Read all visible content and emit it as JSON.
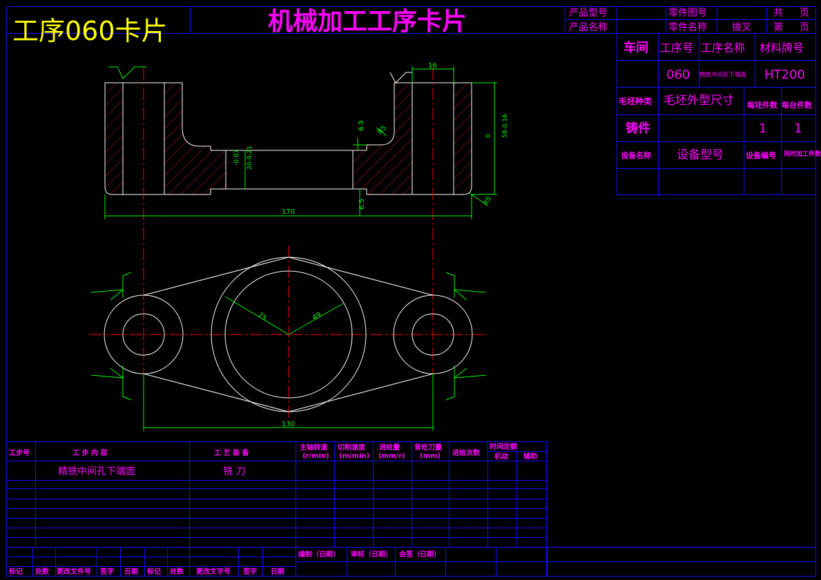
{
  "header": {
    "process_title": "工序060卡片",
    "card_title": "机械加工工序卡片",
    "product_model_label": "产品型号",
    "product_name_label": "产品名称",
    "part_drawing_no_label": "零件图号",
    "part_name_label": "零件名称",
    "part_name_value": "拨叉",
    "total_label": "共",
    "page_label": "页",
    "sheet_label": "第",
    "sheet_page_label": "页"
  },
  "info": {
    "workshop_label": "车间",
    "op_no_label": "工序号",
    "op_name_label": "工序名称",
    "material_label": "材料牌号",
    "op_no_value": "060",
    "op_name_value": "精铣中间孔下端面",
    "material_value": "HT200",
    "blank_type_label": "毛坯种类",
    "blank_size_label": "毛坯外型尺寸",
    "per_blank_label": "每坯件数",
    "per_unit_label": "每台件数",
    "blank_type_value": "铸件",
    "per_blank_value": "1",
    "per_unit_value": "1",
    "equip_name_label": "设备名称",
    "equip_model_label": "设备型号",
    "equip_no_label": "设备编号",
    "simul_label": "同时加工件数"
  },
  "drawing": {
    "dim_16": "16",
    "dim_r5_top": "R5",
    "dim_65_a": "6.5",
    "dim_tol_left": "20-0.07\n-0.21",
    "dim_tol_left_1": "-0.07",
    "dim_tol_left_2": "20-0.21",
    "dim_tol_right_1": "0",
    "dim_tol_right_2": "58-0.16",
    "dim_r5_bottom": "R5",
    "dim_170": "170",
    "dim_65_b": "6.5",
    "dim_75": "75",
    "dim_49": "49",
    "dim_130": "130"
  },
  "steps_table": {
    "step_no_label": "工步号",
    "step_content_label": "工 步 内 容",
    "equipment_label": "工 艺 装 备",
    "spindle_speed_label": "主轴转速",
    "spindle_speed_unit": "(r/min)",
    "cut_speed_label": "切削速度",
    "cut_speed_unit": "(m/min)",
    "feed_label": "进给量",
    "feed_unit": "(mm/r)",
    "depth_label": "背吃刀量",
    "depth_unit": "(mm)",
    "passes_label": "进给次数",
    "time_label": "时间定额",
    "machine_time_label": "机动",
    "aux_time_label": "辅助",
    "row1_content": "精铣中间孔下端面",
    "row1_tool": "铣 刀"
  },
  "footer": {
    "compile_label": "编制（日期）",
    "review_label": "审核（日期）",
    "sign_label": "会签（日期）",
    "cols": [
      "标记",
      "处数",
      "更改文件号",
      "签字",
      "日期",
      "标记",
      "处数",
      "更改文字号",
      "签字",
      "日期"
    ]
  }
}
